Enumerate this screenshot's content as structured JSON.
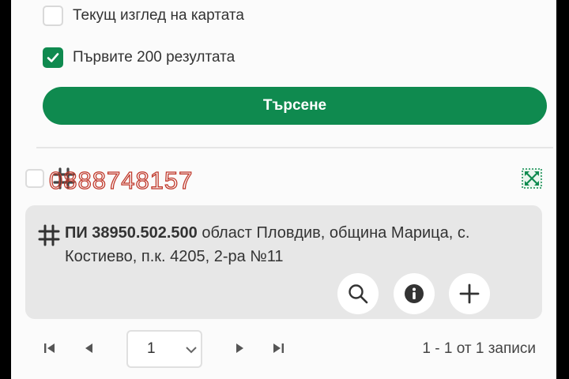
{
  "filters": {
    "current_view_label": "Текущ изглед на картата",
    "current_view_checked": false,
    "first_200_label": "Първите 200 резултата",
    "first_200_checked": true
  },
  "search": {
    "button_label": "Търсене"
  },
  "watermark": {
    "text": "0888748157"
  },
  "result": {
    "title": "ПИ 38950.502.500",
    "address_line1": " област Пловдив, община Марица, с.",
    "address_line2": "Костиево, п.к. 4205, 2-ра №11",
    "actions": [
      "search-icon",
      "info-icon",
      "plus-icon"
    ]
  },
  "pagination": {
    "current_page": "1",
    "records_text": "1 - 1 от 1 записи"
  },
  "colors": {
    "accent": "#0f8a4f",
    "card_bg": "#e7e7e7",
    "watermark": "#c0392b"
  }
}
